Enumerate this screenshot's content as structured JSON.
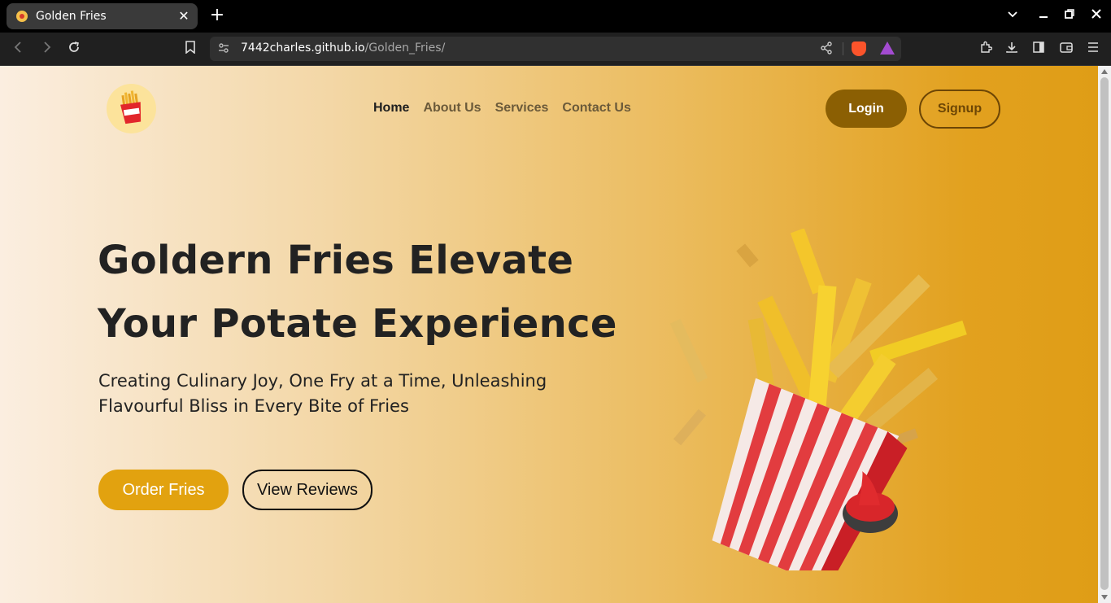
{
  "browser": {
    "tab_title": "Golden Fries",
    "tab_close": "✕",
    "new_tab": "+",
    "url_host": "7442charles.github.io",
    "url_path": "/Golden_Fries/"
  },
  "nav": {
    "items": [
      {
        "label": "Home",
        "active": true
      },
      {
        "label": "About Us",
        "active": false
      },
      {
        "label": "Services",
        "active": false
      },
      {
        "label": "Contact Us",
        "active": false
      }
    ]
  },
  "auth": {
    "login_label": "Login",
    "signup_label": "Signup"
  },
  "hero": {
    "title_line1": "Goldern Fries Elevate",
    "title_line2": "Your Potate Experience",
    "subtitle": "Creating Culinary Joy, One Fry at a Time, Unleashing Flavourful Bliss in Every Bite of Fries",
    "order_button": "Order Fries",
    "reviews_button": "View Reviews"
  },
  "colors": {
    "accent": "#e2a20f",
    "login_bg": "#8b5f03",
    "signup_border": "#6d4605"
  },
  "icons": {
    "logo": "fries-logo-icon",
    "hero": "fries-box-illustration"
  }
}
